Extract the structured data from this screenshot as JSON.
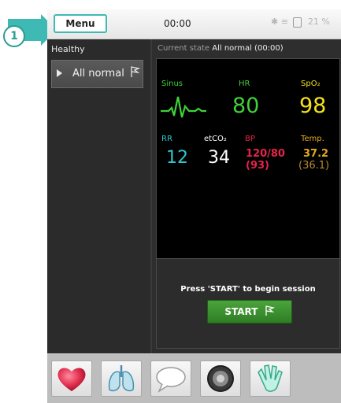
{
  "callout": {
    "number": "1"
  },
  "topbar": {
    "menu_label": "Menu",
    "clock": "00:00",
    "battery_percent": "21 %",
    "icons": [
      "bluetooth-icon",
      "wifi-icon",
      "battery-icon"
    ]
  },
  "left_panel": {
    "category_label": "Healthy",
    "scenarios": [
      {
        "label": "All normal",
        "icon": "flag-icon"
      }
    ]
  },
  "state": {
    "prefix": "Current state",
    "value": "All normal (00:00)"
  },
  "monitor": {
    "rhythm_label": "Sinus",
    "hr_label": "HR",
    "hr_value": "80",
    "spo2_label": "SpO₂",
    "spo2_value": "98",
    "rr_label": "RR",
    "rr_value": "12",
    "etco2_label": "etCO₂",
    "etco2_value": "34",
    "bp_label": "BP",
    "bp_value": "120/80",
    "bp_mean": "(93)",
    "temp_label": "Temp.",
    "temp_value": "37.2",
    "temp_secondary": "(36.1)",
    "colors": {
      "rhythm": "#3fd13a",
      "spo2": "#f2e21b",
      "resp": "#2fc6d2",
      "etco2": "#ffffff",
      "bp": "#e6234a",
      "temp": "#e3a91e",
      "temp_secondary": "#b98a2d"
    }
  },
  "session": {
    "message": "Press 'START' to begin session",
    "start_label": "START"
  },
  "toolbar": {
    "items": [
      "heart-icon",
      "lungs-icon",
      "speech-bubble-icon",
      "speaker-icon",
      "glove-icon"
    ]
  }
}
